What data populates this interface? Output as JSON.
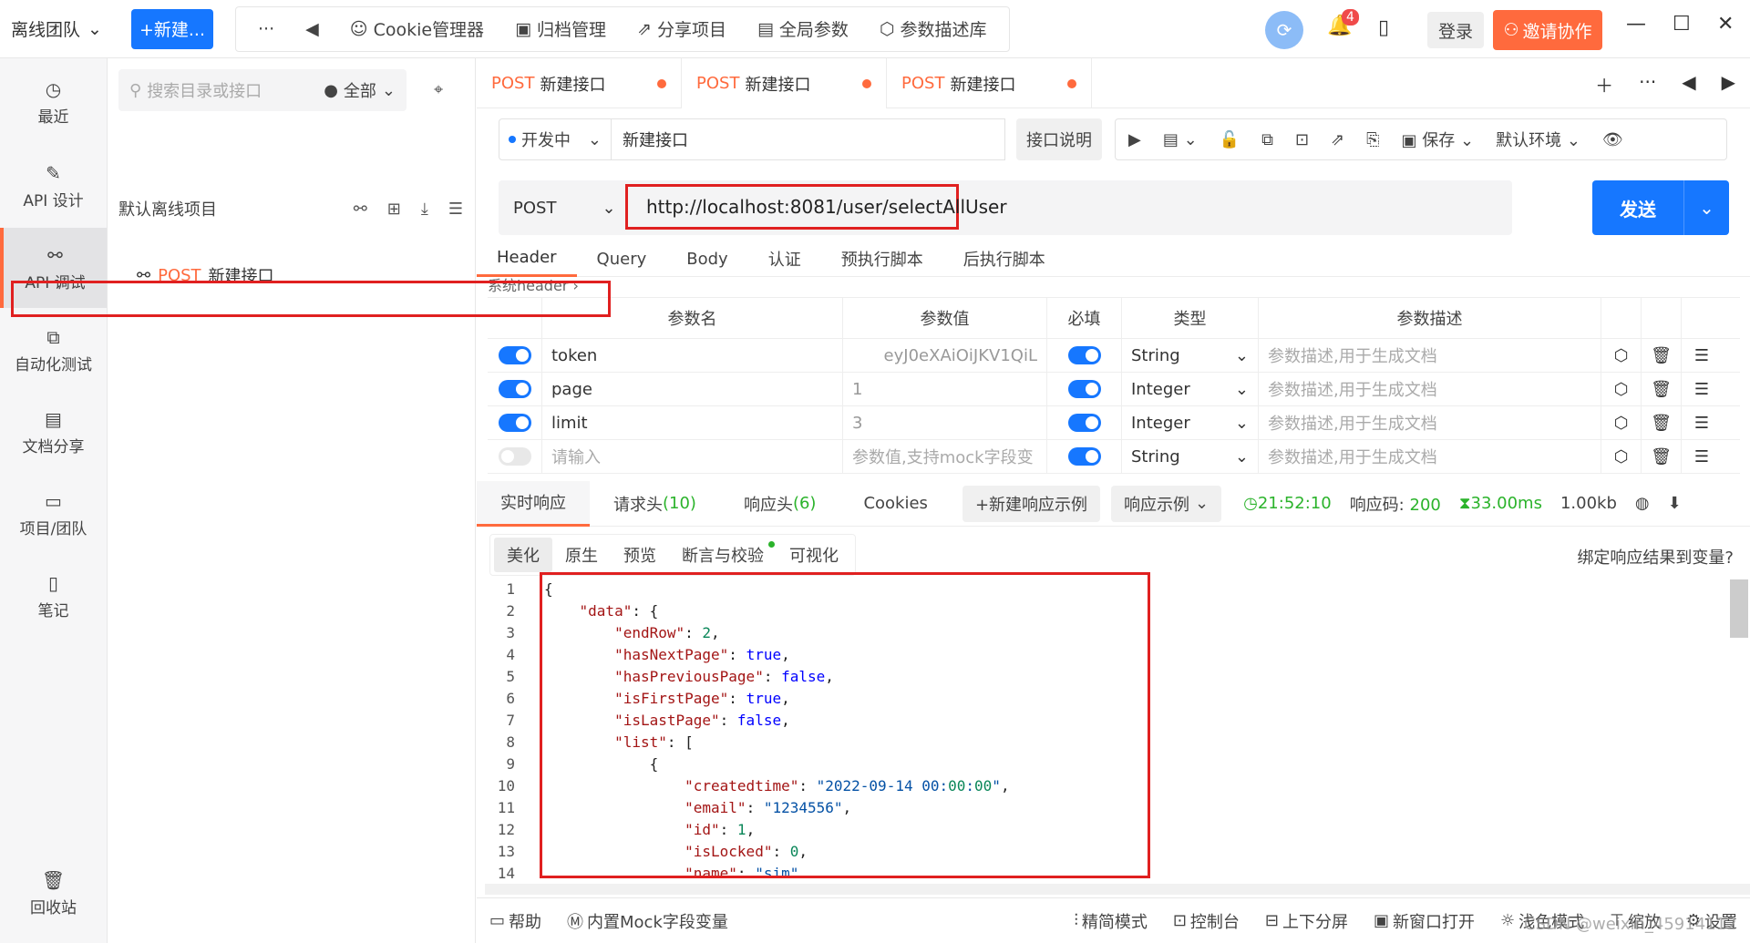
{
  "topbar": {
    "team": "离线团队",
    "new_btn": "+新建...",
    "more": "···",
    "back": "◀",
    "items": [
      "Cookie管理器",
      "归档管理",
      "分享项目",
      "全局参数",
      "参数描述库"
    ],
    "bell_count": "4",
    "login": "登录",
    "invite": "邀请协作"
  },
  "leftnav": {
    "items": [
      "最近",
      "API 设计",
      "API 调试",
      "自动化测试",
      "文档分享",
      "项目/团队",
      "笔记"
    ],
    "trash": "回收站"
  },
  "tree": {
    "search_placeholder": "搜索目录或接口",
    "filter": "全部",
    "project": "默认离线项目",
    "item_method": "POST",
    "item_name": "新建接口"
  },
  "tabs": [
    {
      "method": "POST",
      "name": "新建接口"
    },
    {
      "method": "POST",
      "name": "新建接口"
    },
    {
      "method": "POST",
      "name": "新建接口"
    }
  ],
  "request": {
    "status": "开发中",
    "name": "新建接口",
    "doc_btn": "接口说明",
    "save": "保存",
    "env": "默认环境",
    "method": "POST",
    "url": "http://localhost:8081/user/selectAllUser",
    "send": "发送",
    "tabs": [
      "Header",
      "Query",
      "Body",
      "认证",
      "预执行脚本",
      "后执行脚本"
    ],
    "sysheader": "系统header"
  },
  "params": {
    "headers": [
      "参数名",
      "参数值",
      "必填",
      "类型",
      "参数描述"
    ],
    "rows": [
      {
        "name": "token",
        "value": "eyJ0eXAiOiJKV1QiL",
        "type": "String",
        "desc": "参数描述,用于生成文档"
      },
      {
        "name": "page",
        "value": "1",
        "type": "Integer",
        "desc": "参数描述,用于生成文档"
      },
      {
        "name": "limit",
        "value": "3",
        "type": "Integer",
        "desc": "参数描述,用于生成文档"
      },
      {
        "name": "请输入",
        "value": "参数值,支持mock字段变",
        "type": "String",
        "desc": "参数描述,用于生成文档"
      }
    ]
  },
  "response": {
    "tab_realtime": "实时响应",
    "tab_req_headers": "请求头",
    "req_headers_count": "(10)",
    "tab_resp_headers": "响应头",
    "resp_headers_count": "(6)",
    "tab_cookies": "Cookies",
    "new_example": "+新建响应示例",
    "example": "响应示例",
    "time": "21:52:10",
    "code_label": "响应码:",
    "code": "200",
    "duration": "33.00ms",
    "size": "1.00kb",
    "view_tabs": [
      "美化",
      "原生",
      "预览",
      "断言与校验",
      "可视化"
    ],
    "bind_var": "绑定响应结果到变量?"
  },
  "code_lines": [
    {
      "n": "1",
      "t": "{"
    },
    {
      "n": "2",
      "t": "    \"data\": {"
    },
    {
      "n": "3",
      "t": "        \"endRow\": 2,"
    },
    {
      "n": "4",
      "t": "        \"hasNextPage\": true,"
    },
    {
      "n": "5",
      "t": "        \"hasPreviousPage\": false,"
    },
    {
      "n": "6",
      "t": "        \"isFirstPage\": true,"
    },
    {
      "n": "7",
      "t": "        \"isLastPage\": false,"
    },
    {
      "n": "8",
      "t": "        \"list\": ["
    },
    {
      "n": "9",
      "t": "            {"
    },
    {
      "n": "10",
      "t": "                \"createdtime\": \"2022-09-14 00:00:00\","
    },
    {
      "n": "11",
      "t": "                \"email\": \"1234556\","
    },
    {
      "n": "12",
      "t": "                \"id\": 1,"
    },
    {
      "n": "13",
      "t": "                \"isLocked\": 0,"
    },
    {
      "n": "14",
      "t": "                \"name\": \"sim\","
    }
  ],
  "bottombar": {
    "items": [
      "帮助",
      "内置Mock字段变量",
      "精简模式",
      "控制台",
      "上下分屏",
      "新窗口打开",
      "浅色模式",
      "缩放",
      "设置"
    ]
  },
  "watermark": "CSDN @weixin_45914112"
}
